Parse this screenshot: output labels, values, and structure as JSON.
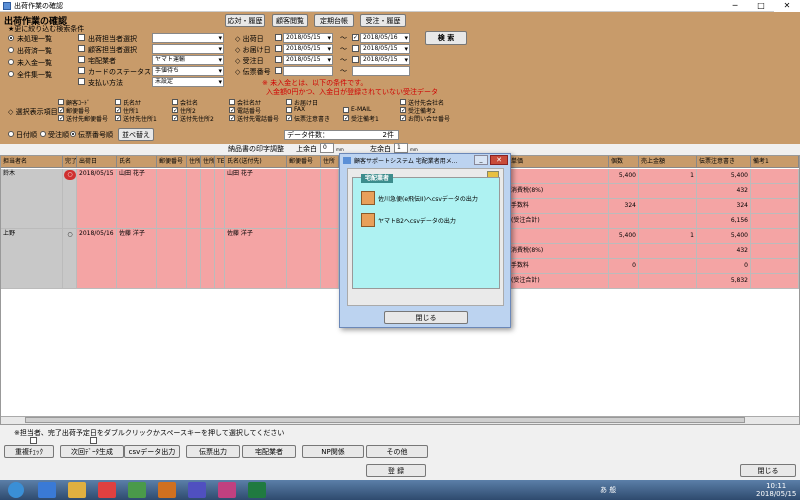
{
  "window": {
    "title": "出荷作業の確認",
    "min": "─",
    "max": "□",
    "close": "✕"
  },
  "filter": {
    "title": "出荷作業の確認",
    "subtitle": "★更に絞り込む検索条件",
    "status_radios": [
      "未処理一覧",
      "出荷済一覧",
      "未入金一覧",
      "全件集一覧"
    ],
    "checks": [
      "出荷担当者選択",
      "顧客担当者選択",
      "宅配業者",
      "カードのステータス",
      "支払い方法"
    ],
    "dropdowns": [
      "",
      "",
      "ヤマト運輸",
      "手値待ち",
      "未設定"
    ],
    "date_labels": [
      "出荷日",
      "お届け日",
      "受注日",
      "伝票番号"
    ],
    "date_from": [
      "2018/05/15",
      "2018/05/15",
      "2018/05/15",
      ""
    ],
    "date_to": [
      "2018/05/16",
      "2018/05/15",
      "2018/05/15",
      ""
    ],
    "tilde": "〜",
    "search_btn": "検 索",
    "top_buttons": [
      "応対・履歴",
      "顧客閲覧",
      "定期台帳",
      "受注・履歴"
    ],
    "warn1": "※ 未入金とは、以下の条件です。",
    "warn2": "入金額0円かつ、入金日が登録されていない受注データ",
    "display_label": "選択表示項目",
    "display_cols": [
      [
        {
          "t": "顧客ｺｰﾄﾞ",
          "c": false
        },
        {
          "t": "郵便番号",
          "c": true
        },
        {
          "t": "送付先郵便番号",
          "c": true
        }
      ],
      [
        {
          "t": "氏名ｶﾅ",
          "c": false
        },
        {
          "t": "住所1",
          "c": true
        },
        {
          "t": "送付先住所1",
          "c": true
        }
      ],
      [
        {
          "t": "会社名",
          "c": false
        },
        {
          "t": "住所2",
          "c": true
        },
        {
          "t": "送付先住所2",
          "c": true
        }
      ],
      [
        {
          "t": "会社名ｶﾅ",
          "c": false
        },
        {
          "t": "電話番号",
          "c": true
        },
        {
          "t": "送付先電話番号",
          "c": true
        }
      ],
      [
        {
          "t": "お届け日",
          "c": false
        },
        {
          "t": "FAX",
          "c": false
        },
        {
          "t": "伝票注意書き",
          "c": true
        }
      ],
      [
        {
          "t": "",
          "c": false
        },
        {
          "t": "E-MAIL",
          "c": false
        },
        {
          "t": "受注備考1",
          "c": true
        }
      ],
      [
        {
          "t": "送付先会社名",
          "c": false
        },
        {
          "t": "受注備考2",
          "c": true
        },
        {
          "t": "お問い合せ番号",
          "c": true
        }
      ]
    ],
    "sort_radios": [
      "日付順",
      "受注順",
      "伝票番号順"
    ],
    "sort_btn": "並べ替え",
    "count_label": "データ件数：",
    "count_value": "2件"
  },
  "print": {
    "label": "納品書の印字調整",
    "top_margin": "上余白",
    "top_value": "0",
    "left_margin": "左余白",
    "left_value": "1",
    "unit": "mm"
  },
  "grid": {
    "headers": [
      "担当者名",
      "完了",
      "出荷日",
      "氏名",
      "郵便番号",
      "住所1",
      "住所2",
      "TEL",
      "氏名(送付先)",
      "郵便番号",
      "住所",
      "",
      "単価",
      "個数",
      "売上金額",
      "伝票注意書き",
      "備考1"
    ],
    "rows": [
      {
        "staff": "鈴木",
        "done": "○",
        "date": "2018/05/15",
        "name": "山田 花子",
        "ship_name": "山田 花子",
        "unit": "5,400",
        "qty": "1",
        "amount": "5,400",
        "sub": [
          [
            "消費税(8%)",
            "",
            "432"
          ],
          [
            "手数料",
            "324",
            "324"
          ],
          [
            "(受注合計)",
            "",
            "6,156"
          ]
        ]
      },
      {
        "staff": "上野",
        "done": "○",
        "date": "2018/05/16",
        "name": "佐藤 洋子",
        "ship_name": "佐藤 洋子",
        "unit": "5,400",
        "qty": "1",
        "amount": "5,400",
        "sub": [
          [
            "消費税(8%)",
            "",
            "432"
          ],
          [
            "手数料",
            "0",
            "0"
          ],
          [
            "(受注合計)",
            "",
            "5,832"
          ]
        ]
      }
    ]
  },
  "modal": {
    "title": "顧客サポートシステム 宅配業者用メ...",
    "group": "宅配業者",
    "options": [
      "佐川急便(e飛伝II)へcsvデータの出力",
      "ヤマトB2へcsvデータの出力"
    ],
    "close": "閉じる"
  },
  "footer": {
    "note": "※担当者、完了出荷予定日をダブルクリックかスペースキーを押して選択してください",
    "buttons": [
      "重複ﾁｪｯｸ",
      "次回ﾃﾞｰﾀ生成",
      "csvデータ出力",
      "伝票出力",
      "宅配業者",
      "NP関係",
      "その他"
    ],
    "register": "登 録",
    "close": "閉じる"
  },
  "taskbar": {
    "icons": [
      "start-orb",
      "ie",
      "folder",
      "chrome",
      "app1",
      "app2",
      "app3",
      "app4",
      "excel"
    ],
    "time": "10:11",
    "date": "2018/05/15",
    "lang": "あ 般"
  }
}
